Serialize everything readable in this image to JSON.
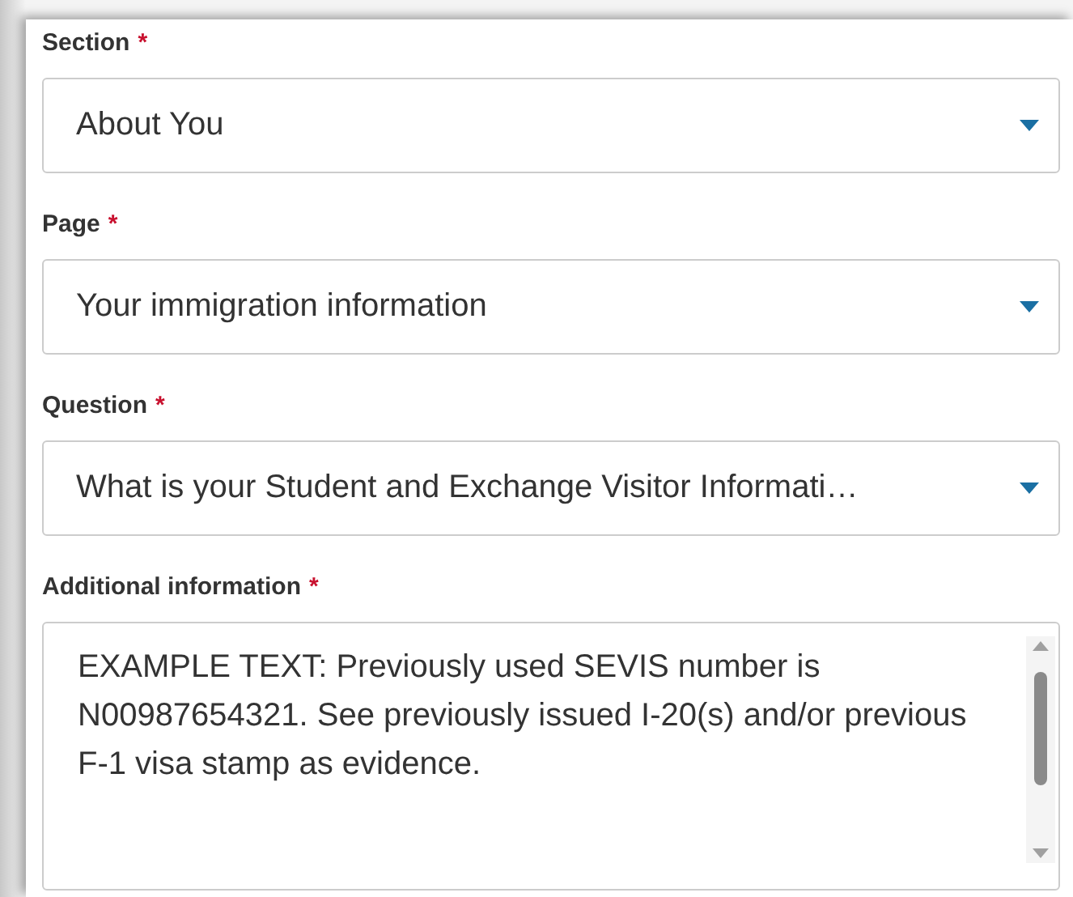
{
  "fields": [
    {
      "kind": "select",
      "label": "Section",
      "required_mark": "*",
      "value": "About You"
    },
    {
      "kind": "select",
      "label": "Page",
      "required_mark": "*",
      "value": "Your immigration information"
    },
    {
      "kind": "select",
      "label": "Question",
      "required_mark": "*",
      "value": "What is your Student and Exchange Visitor Informati…"
    },
    {
      "kind": "textarea",
      "label": "Additional information",
      "required_mark": "*",
      "value": "EXAMPLE TEXT: Previously used SEVIS number is N00987654321. See previously issued I-20(s) and/or previous F-1 visa stamp as evidence."
    }
  ]
}
